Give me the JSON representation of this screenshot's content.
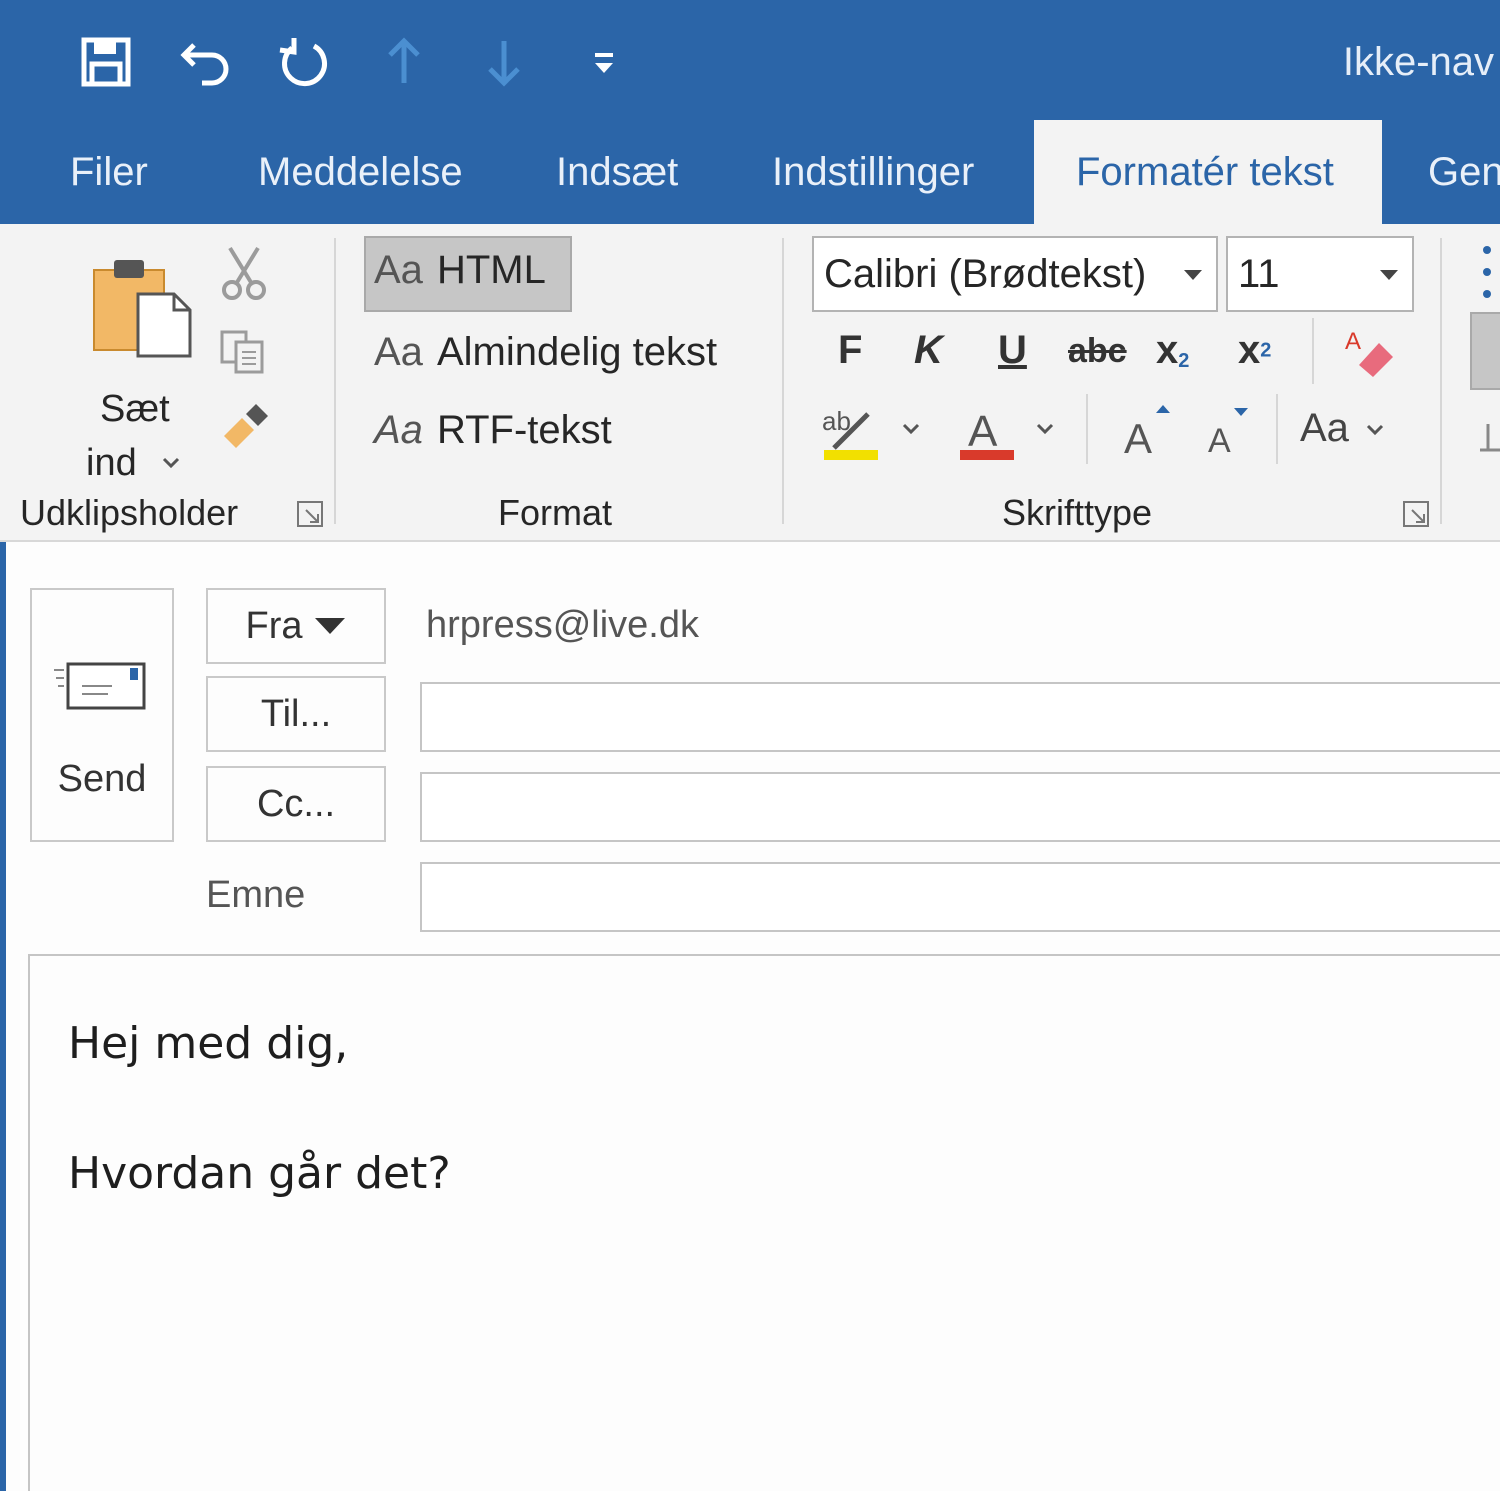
{
  "titlebar": {
    "doc_title": "Ikke-nav",
    "qat": [
      "save-icon",
      "undo-icon",
      "redo-icon",
      "up-arrow-icon",
      "down-arrow-icon",
      "customize-qat-icon"
    ]
  },
  "tabs": [
    {
      "label": "Filer"
    },
    {
      "label": "Meddelelse"
    },
    {
      "label": "Indsæt"
    },
    {
      "label": "Indstillinger"
    },
    {
      "label": "Formatér tekst",
      "active": true
    },
    {
      "label": "Gen"
    }
  ],
  "ribbon": {
    "clipboard": {
      "paste_line1": "Sæt",
      "paste_line2": "ind",
      "group_label": "Udklipsholder"
    },
    "format": {
      "prefix": "Aa",
      "html": "HTML",
      "plain": "Almindelig tekst",
      "rtf": "RTF-tekst",
      "group_label": "Format"
    },
    "font": {
      "font_name": "Calibri (Brødtekst)",
      "font_size": "11",
      "bold": "F",
      "italic": "K",
      "underline": "U",
      "strike": "abc",
      "subscript": "x",
      "superscript": "x",
      "change_case": "Aa",
      "group_label": "Skrifttype",
      "highlight_color": "#f2e000",
      "font_color": "#d93a2b"
    }
  },
  "header": {
    "send_label": "Send",
    "from_button": "Fra",
    "from_address": "hrpress@live.dk",
    "to_button": "Til...",
    "cc_button": "Cc...",
    "subject_label": "Emne",
    "to_value": "",
    "cc_value": "",
    "subject_value": ""
  },
  "body": {
    "lines": [
      "Hej med dig,",
      "Hvordan går det?"
    ]
  },
  "colors": {
    "accent": "#2b65a8",
    "ribbon": "#f3f3f3"
  }
}
